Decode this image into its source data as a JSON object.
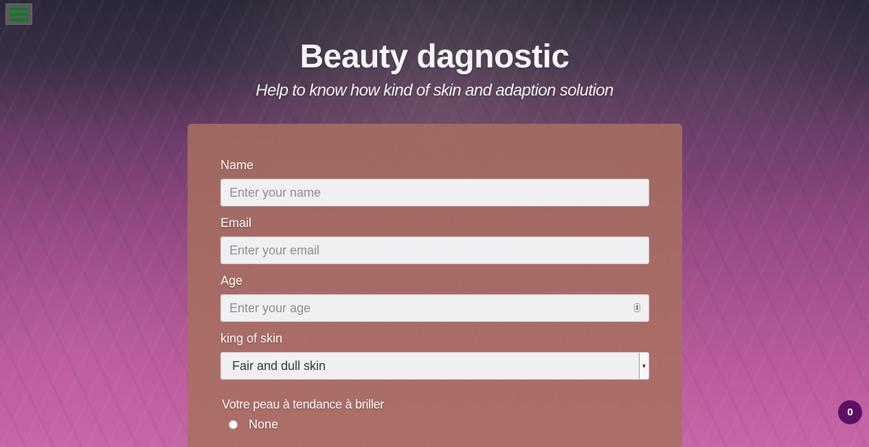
{
  "nav": {
    "menu_icon": "hamburger-menu-icon"
  },
  "hero": {
    "title": "Beauty dagnostic",
    "subtitle": "Help to know how kind of skin and adaption solution"
  },
  "form": {
    "name": {
      "label": "Name",
      "placeholder": "Enter your name",
      "value": ""
    },
    "email": {
      "label": "Email",
      "placeholder": "Enter your email",
      "value": ""
    },
    "age": {
      "label": "Age",
      "placeholder": "Enter your age",
      "value": ""
    },
    "skin_kind": {
      "label": "king of skin",
      "selected": "Fair and dull skin"
    },
    "shine": {
      "title": "Votre peau à tendance à briller",
      "options": [
        {
          "label": "None",
          "selected": false
        }
      ]
    }
  },
  "cart": {
    "count": "0"
  },
  "colors": {
    "menu_bars": "#0b7d1f",
    "card_bg": "#a87060",
    "badge_bg": "#5b1064"
  }
}
